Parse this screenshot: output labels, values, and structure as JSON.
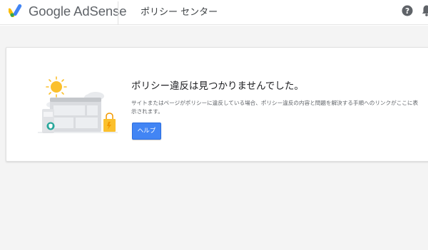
{
  "header": {
    "brand": "Google AdSense",
    "page_title": "ポリシー センター",
    "icons": [
      "adsense-logo-icon",
      "help-icon",
      "notifications-icon"
    ]
  },
  "card": {
    "heading": "ポリシー違反は見つかりませんでした。",
    "description": "サイトまたはページがポリシーに違反している場合、ポリシー違反の内容と問題を解決する手順へのリンクがここに表示されます。",
    "help_button": "ヘルプ"
  },
  "colors": {
    "primary_button": "#4285f4",
    "sun": "#fbc02d",
    "shield_badge": "#26a69a",
    "page_background": "#f4f4f4"
  }
}
